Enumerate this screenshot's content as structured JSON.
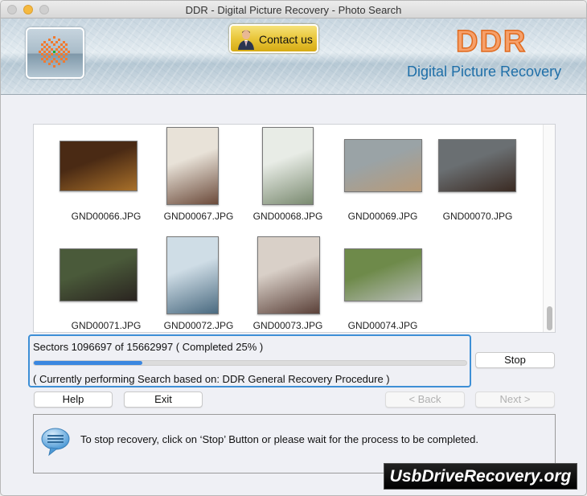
{
  "window": {
    "title": "DDR - Digital Picture Recovery - Photo Search"
  },
  "header": {
    "contact_label": "Contact us",
    "brand_name": "DDR",
    "brand_subtitle": "Digital Picture Recovery"
  },
  "gallery": {
    "files": [
      {
        "name": "GND00066.JPG",
        "colors": [
          "#4a2a14",
          "#a8702a"
        ]
      },
      {
        "name": "GND00067.JPG",
        "colors": [
          "#e8e2d8",
          "#6b4a3a"
        ]
      },
      {
        "name": "GND00068.JPG",
        "colors": [
          "#e8ece6",
          "#7a8a70"
        ]
      },
      {
        "name": "GND00069.JPG",
        "colors": [
          "#9aa3a6",
          "#b89a78"
        ]
      },
      {
        "name": "GND00070.JPG",
        "colors": [
          "#6a6f72",
          "#3a2a22"
        ]
      },
      {
        "name": "GND00071.JPG",
        "colors": [
          "#4a5a3a",
          "#2a2420"
        ]
      },
      {
        "name": "GND00072.JPG",
        "colors": [
          "#cfdde6",
          "#4a6a80"
        ]
      },
      {
        "name": "GND00073.JPG",
        "colors": [
          "#d9d0c8",
          "#5a4038"
        ]
      },
      {
        "name": "GND00074.JPG",
        "colors": [
          "#6e8a4a",
          "#b8bcb8"
        ]
      }
    ]
  },
  "progress": {
    "sectors_text": "Sectors 1096697 of 15662997  ( Completed 25% )",
    "percent": 25,
    "current_text": "( Currently performing Search based on: DDR General Recovery Procedure )",
    "accent": "#3b87e0"
  },
  "buttons": {
    "stop": "Stop",
    "help": "Help",
    "exit": "Exit",
    "back": "< Back",
    "next": "Next >"
  },
  "info": {
    "icon": "speech-bubble-icon",
    "message": "To stop recovery, click on ‘Stop’ Button or please wait for the process to be completed."
  },
  "watermark": "UsbDriveRecovery.org"
}
